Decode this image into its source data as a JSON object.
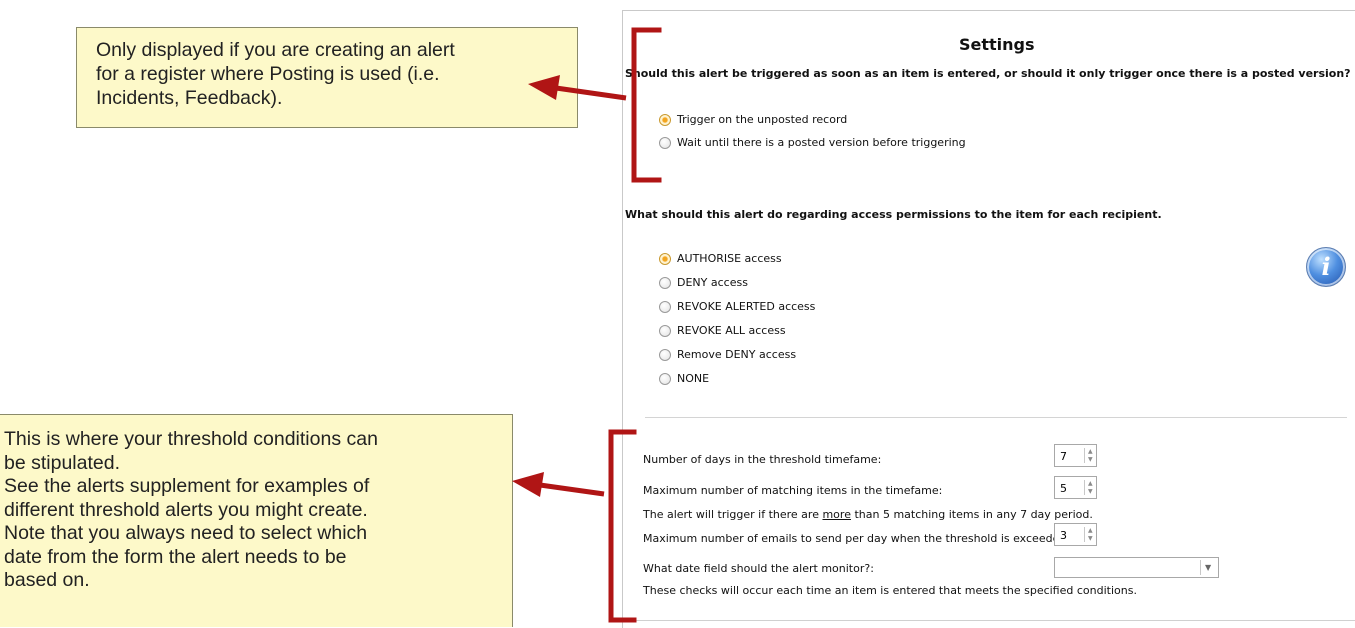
{
  "callouts": {
    "top": {
      "lines": [
        "Only displayed if you are creating an alert",
        "for a register where Posting is used (i.e.",
        "Incidents, Feedback)."
      ]
    },
    "bottom": {
      "lines": [
        "This is where your threshold conditions can",
        "be stipulated.",
        "See the alerts supplement for examples of",
        "different threshold alerts you might create.",
        "Note that you always need to select which",
        "date from the form the alert needs to be",
        "based on."
      ]
    }
  },
  "settings": {
    "title": "Settings",
    "posting_question": "Should this alert be triggered as soon as an item is entered, or should it only trigger once there is a posted version?",
    "posting_options": [
      {
        "label": "Trigger on the unposted record",
        "selected": true
      },
      {
        "label": "Wait until there is a posted version before triggering",
        "selected": false
      }
    ],
    "access_question": "What should this alert do regarding access permissions to the item for each recipient.",
    "access_options": [
      {
        "label": "AUTHORISE access",
        "selected": true
      },
      {
        "label": "DENY access",
        "selected": false
      },
      {
        "label": "REVOKE ALERTED access",
        "selected": false
      },
      {
        "label": "REVOKE ALL access",
        "selected": false
      },
      {
        "label": "Remove DENY access",
        "selected": false
      },
      {
        "label": "NONE",
        "selected": false
      }
    ],
    "threshold": {
      "days_label": "Number of days in the threshold timefame:",
      "days_value": "7",
      "max_items_label": "Maximum number of matching items in the timefame:",
      "max_items_value": "5",
      "summary_prefix": "The alert will trigger if there are ",
      "summary_emph": "more",
      "summary_suffix": " than 5 matching items in any 7 day period.",
      "max_emails_label": "Maximum number of emails to send per day when the threshold is exceeded:",
      "max_emails_value": "3",
      "date_field_label": "What date field should the alert monitor?:",
      "date_field_value": "",
      "footer_note": "These checks will occur each time an item is entered that meets the specified conditions."
    }
  },
  "icons": {
    "info": "info-icon",
    "spinner_arrows": "spinner-arrows-icon",
    "dropdown": "chevron-down-icon"
  },
  "colors": {
    "callout_bg": "#fdf9c9",
    "annotation_red": "#b01515",
    "radio_selected": "#f3a51f"
  }
}
